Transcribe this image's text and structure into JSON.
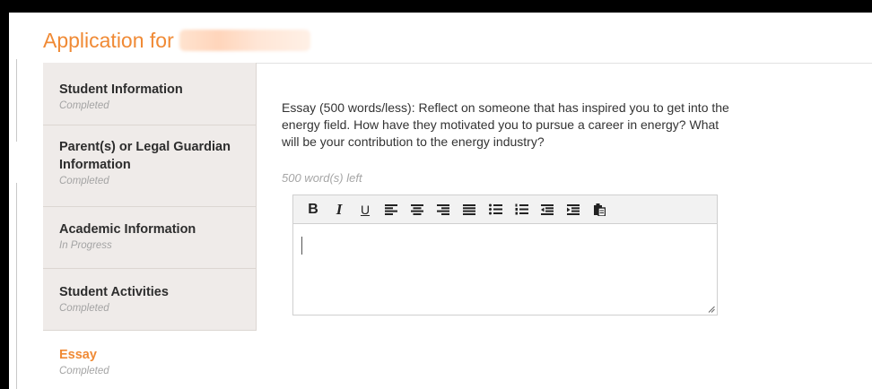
{
  "page": {
    "title": "Application for"
  },
  "sidebar": {
    "items": [
      {
        "label": "Student Information",
        "status": "Completed"
      },
      {
        "label": "Parent(s) or Legal Guardian Information",
        "status": "Completed"
      },
      {
        "label": "Academic Information",
        "status": "In Progress"
      },
      {
        "label": "Student Activities",
        "status": "Completed"
      },
      {
        "label": "Essay",
        "status": "Completed"
      }
    ],
    "active_index": 4
  },
  "essay": {
    "prompt": "Essay (500 words/less): Reflect on someone that has inspired you to get into the energy field. How have they motivated you to pursue a career in energy? What will be your contribution to the energy industry?",
    "words_left": "500 word(s) left",
    "value": ""
  },
  "toolbar": {
    "bold": "B",
    "italic": "I",
    "underline": "U",
    "icons": [
      "bold-icon",
      "italic-icon",
      "underline-icon",
      "align-left-icon",
      "align-center-icon",
      "align-right-icon",
      "align-justify-icon",
      "bulleted-list-icon",
      "numbered-list-icon",
      "outdent-icon",
      "indent-icon",
      "paste-icon"
    ]
  },
  "colors": {
    "accent": "#f08a35",
    "sidebar_bg": "#efebe9",
    "muted": "#a4a4a4"
  }
}
